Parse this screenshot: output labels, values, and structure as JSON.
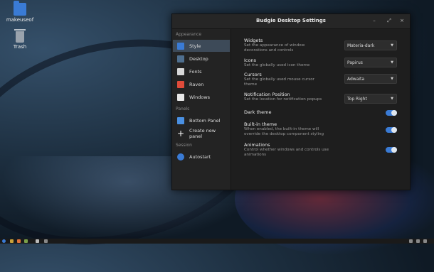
{
  "desktop": {
    "icons": [
      {
        "label": "makeuseof",
        "icon": "folder-icon"
      },
      {
        "label": "Trash",
        "icon": "trash-icon"
      }
    ]
  },
  "window": {
    "title": "Budgie Desktop Settings",
    "controls": {
      "minimize": "–",
      "maximize": "⤢",
      "close": "×"
    }
  },
  "sidebar": {
    "sections": {
      "appearance": "Appearance",
      "panels": "Panels",
      "session": "Session"
    },
    "items": [
      {
        "label": "Style",
        "icon": "style-icon",
        "color": "#3a7bd5"
      },
      {
        "label": "Desktop",
        "icon": "desktop-icon",
        "color": "#4f6f8f"
      },
      {
        "label": "Fonts",
        "icon": "fonts-icon",
        "color": "#d8d8d8"
      },
      {
        "label": "Raven",
        "icon": "raven-icon",
        "color": "#e04b3a"
      },
      {
        "label": "Windows",
        "icon": "windows-icon",
        "color": "#e8e8e8"
      },
      {
        "label": "Bottom Panel",
        "icon": "panel-icon",
        "color": "#4a90e2"
      },
      {
        "label": "Create new panel",
        "icon": "plus-icon",
        "color": "#ffffff"
      },
      {
        "label": "Autostart",
        "icon": "autostart-icon",
        "color": "#3a7bd5"
      }
    ]
  },
  "settings": {
    "widgets": {
      "label": "Widgets",
      "desc": "Set the appearance of window decorations and controls",
      "value": "Materia-dark"
    },
    "icons": {
      "label": "Icons",
      "desc": "Set the globally used icon theme",
      "value": "Papirus"
    },
    "cursors": {
      "label": "Cursors",
      "desc": "Set the globally used mouse cursor theme",
      "value": "Adwaita"
    },
    "notification": {
      "label": "Notification Position",
      "desc": "Set the location for notification popups",
      "value": "Top Right"
    },
    "dark_theme": {
      "label": "Dark theme",
      "on": true
    },
    "builtin_theme": {
      "label": "Built-in theme",
      "desc": "When enabled, the built-in theme will override the desktop component styling",
      "on": true
    },
    "animations": {
      "label": "Animations",
      "desc": "Control whether windows and controls use animations",
      "on": true
    }
  },
  "colors": {
    "accent": "#3a7bd5",
    "window_bg": "#1e1e1e",
    "sidebar_active": "#3d4a58"
  }
}
